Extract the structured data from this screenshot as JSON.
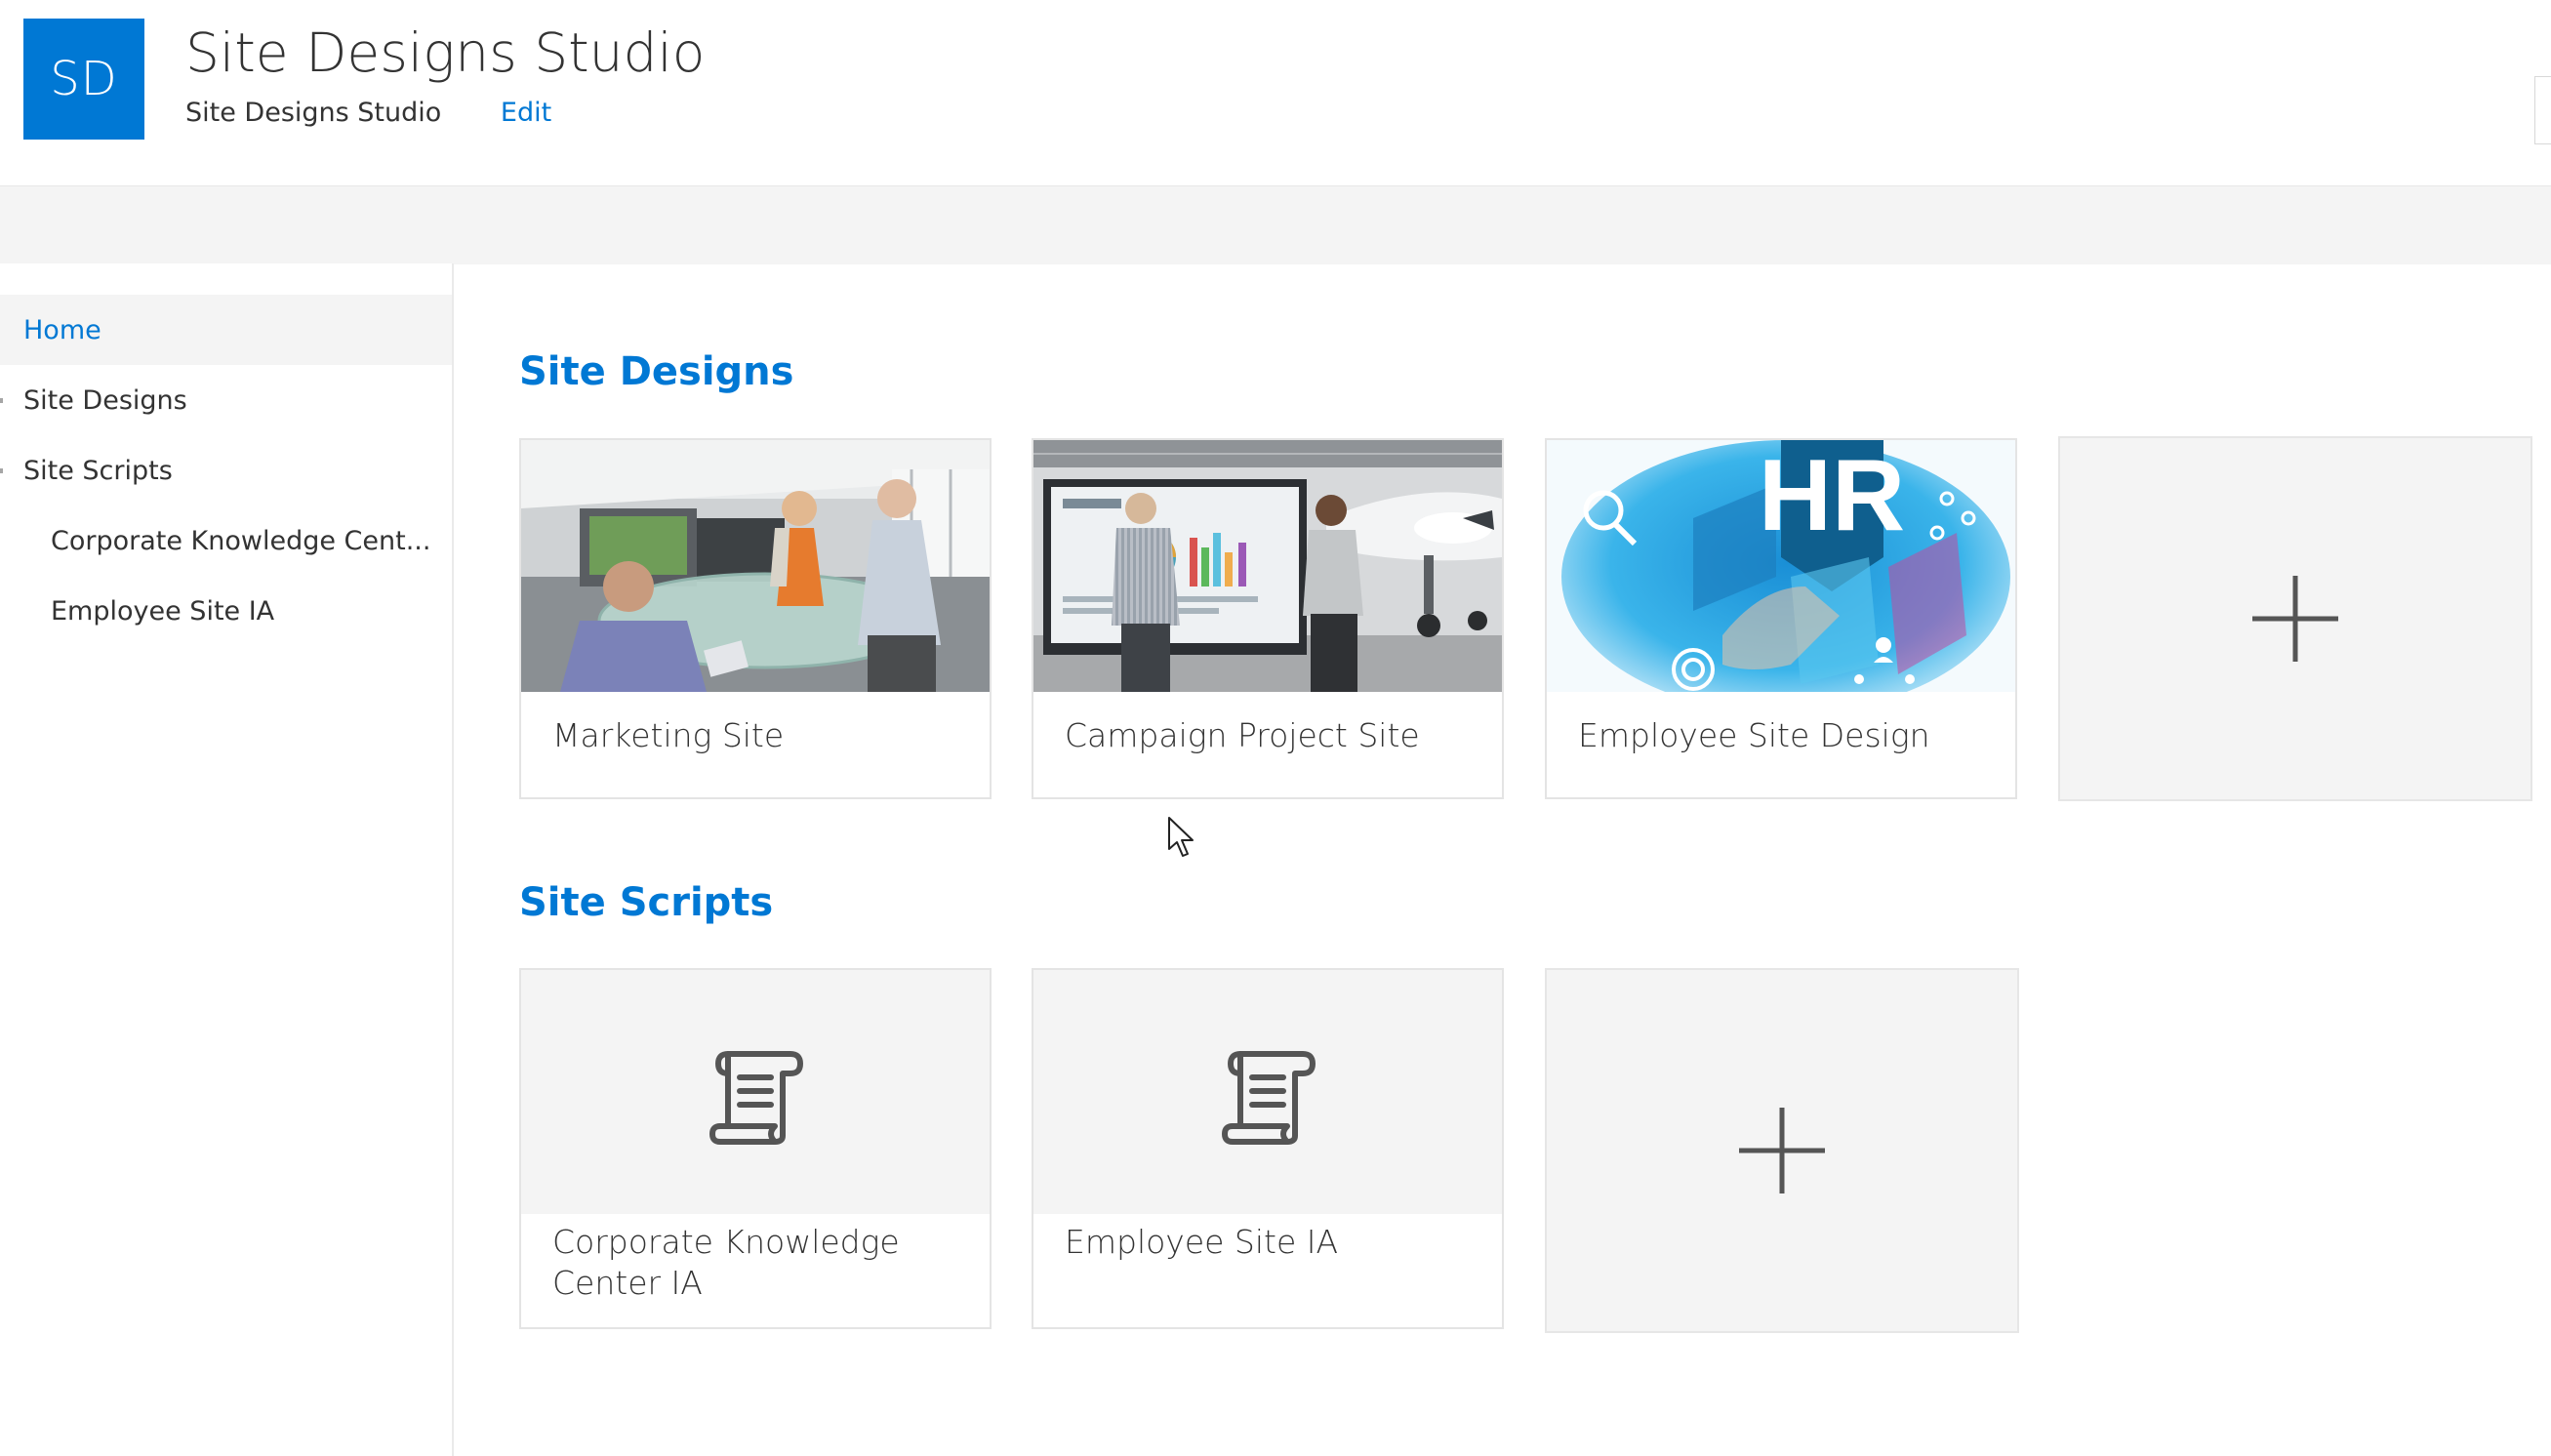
{
  "header": {
    "logo_text": "SD",
    "title": "Site Designs Studio",
    "breadcrumb": "Site Designs Studio",
    "edit_label": "Edit"
  },
  "colors": {
    "accent": "#0078d4",
    "command_bar": "#f4f4f4",
    "tile_bg": "#f4f4f4"
  },
  "nav": {
    "items": [
      {
        "label": "Home",
        "selected": true
      },
      {
        "label": "Site Designs"
      },
      {
        "label": "Site Scripts"
      },
      {
        "label": "Corporate Knowledge Cent..."
      },
      {
        "label": "Employee Site IA"
      }
    ]
  },
  "site_designs": {
    "heading": "Site Designs",
    "cards": [
      {
        "title": "Marketing Site",
        "image": "office-meeting-photo"
      },
      {
        "title": "Campaign Project Site",
        "image": "hangar-presentation-photo"
      },
      {
        "title": "Employee Site Design",
        "image": "hr-banner-image"
      }
    ],
    "add_icon": "plus-icon"
  },
  "site_scripts": {
    "heading": "Site Scripts",
    "cards": [
      {
        "title": "Corporate Knowledge Center IA",
        "icon": "script-scroll-icon"
      },
      {
        "title": "Employee Site IA",
        "icon": "script-scroll-icon"
      }
    ],
    "add_icon": "plus-icon"
  },
  "hr_image_text": "HR"
}
